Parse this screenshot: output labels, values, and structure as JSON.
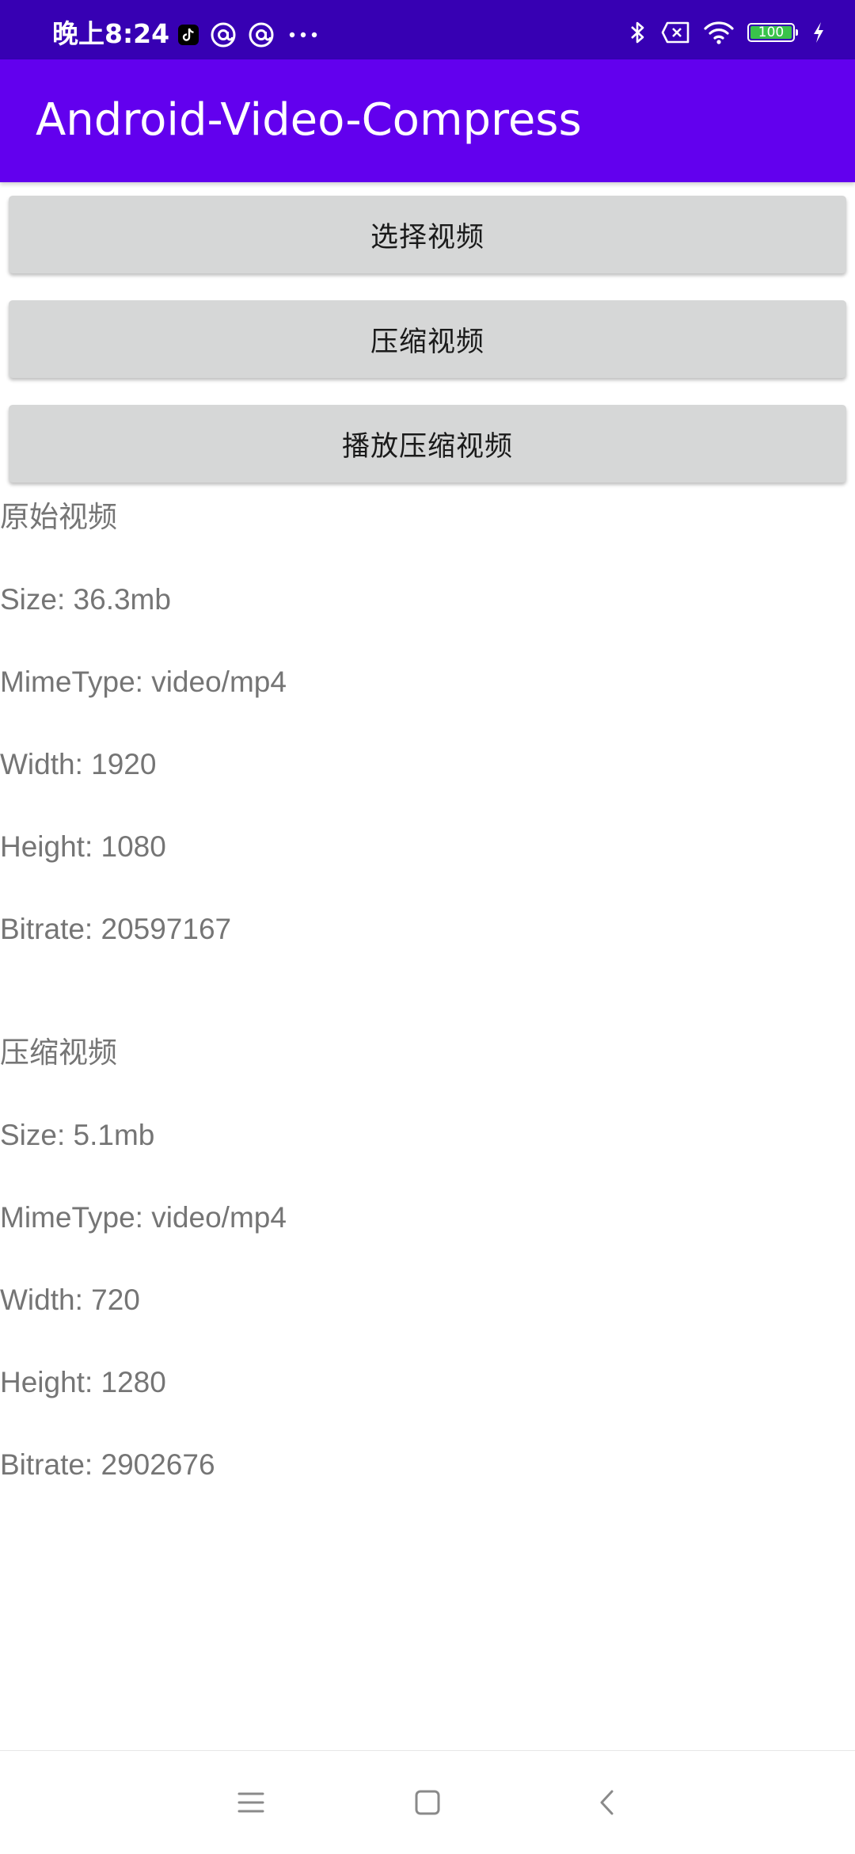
{
  "status_bar": {
    "time": "晚上8:24",
    "left_icons": [
      "tiktok-icon",
      "at-sign-icon",
      "at-sign-icon",
      "more-dots-icon"
    ],
    "right_icons": [
      "bluetooth-icon",
      "no-sim-icon",
      "wifi-icon",
      "battery-icon",
      "charging-icon"
    ],
    "battery_level": "100",
    "background_color": "#3700b3"
  },
  "app_bar": {
    "title": "Android-Video-Compress",
    "background_color": "#6200ee"
  },
  "buttons": {
    "select_video": "选择视频",
    "compress_video": "压缩视频",
    "play_compressed_video": "播放压缩视频"
  },
  "original_video": {
    "heading": "原始视频",
    "size": "Size: 36.3mb",
    "mime_type": "MimeType: video/mp4",
    "width": "Width: 1920",
    "height": "Height: 1080",
    "bitrate": "Bitrate: 20597167"
  },
  "compressed_video": {
    "heading": "压缩视频",
    "size": "Size: 5.1mb",
    "mime_type": "MimeType: video/mp4",
    "width": "Width: 720",
    "height": "Height: 1280",
    "bitrate": "Bitrate: 2902676"
  },
  "nav_bar": {
    "icons": [
      "menu-icon",
      "home-icon",
      "back-icon"
    ]
  }
}
